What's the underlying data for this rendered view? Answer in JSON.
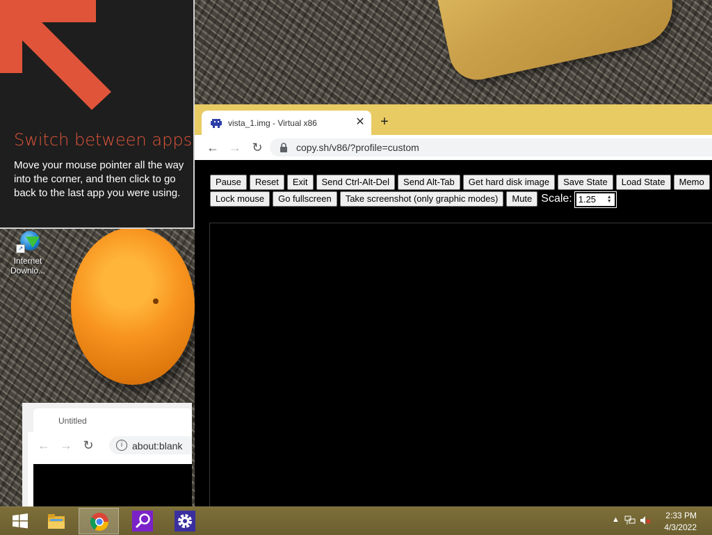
{
  "tip": {
    "title": "Switch between apps",
    "body": "Move your mouse pointer all the way into the corner, and then click to go back to the last app you were using."
  },
  "desktop_icons": [
    {
      "label_line1": "Internet",
      "label_line2": "Downlo..."
    }
  ],
  "browser": {
    "tab_title": "vista_1.img - Virtual x86",
    "new_tab_symbol": "+",
    "close_symbol": "✕",
    "url": "copy.sh/v86/?profile=custom",
    "buttons_row1": [
      "Pause",
      "Reset",
      "Exit",
      "Send Ctrl-Alt-Del",
      "Send Alt-Tab",
      "Get hard disk image",
      "Save State",
      "Load State",
      "Memo"
    ],
    "buttons_row2": [
      "Lock mouse",
      "Go fullscreen",
      "Take screenshot (only graphic modes)",
      "Mute"
    ],
    "scale_label": "Scale:",
    "scale_value": "1.25"
  },
  "mini_browser": {
    "tab_title": "Untitled",
    "close_symbol": "✕",
    "url": "about:blank"
  },
  "taskbar": {
    "time": "2:33 PM",
    "date": "4/3/2022",
    "apps": [
      "windows-start",
      "file-explorer",
      "chrome",
      "search-app",
      "settings-app"
    ],
    "active_app": "chrome"
  },
  "colors": {
    "tip_accent": "#e0553a",
    "browser_frame": "#e9cb63",
    "taskbar": "#6e6233"
  }
}
